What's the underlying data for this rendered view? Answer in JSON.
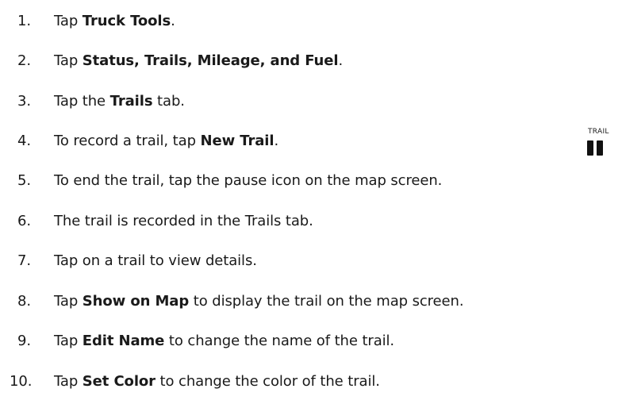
{
  "steps": [
    {
      "num": "1.",
      "pre": "Tap ",
      "bold": "Truck Tools",
      "post": "."
    },
    {
      "num": "2.",
      "pre": "Tap ",
      "bold": "Status, Trails, Mileage, and Fuel",
      "post": "."
    },
    {
      "num": "3.",
      "pre": "Tap the ",
      "bold": "Trails",
      "post": " tab."
    },
    {
      "num": "4.",
      "pre": "To record a trail, tap ",
      "bold": "New Trail",
      "post": "."
    },
    {
      "num": "5.",
      "pre": "To end the trail, tap the pause icon on the map screen.",
      "bold": "",
      "post": ""
    },
    {
      "num": "6.",
      "pre": "The trail is recorded in the Trails tab.",
      "bold": "",
      "post": ""
    },
    {
      "num": "7.",
      "pre": "Tap on a trail to view details.",
      "bold": "",
      "post": ""
    },
    {
      "num": "8.",
      "pre": "Tap ",
      "bold": "Show on Map",
      "post": " to display the trail on the map screen."
    },
    {
      "num": "9.",
      "pre": "Tap ",
      "bold": "Edit Name",
      "post": " to change the name of the trail."
    },
    {
      "num": "10.",
      "pre": "Tap ",
      "bold": "Set Color",
      "post": " to change the color of the trail."
    }
  ],
  "pause_icon": {
    "label": "TRAIL",
    "icon": "pause-icon"
  }
}
